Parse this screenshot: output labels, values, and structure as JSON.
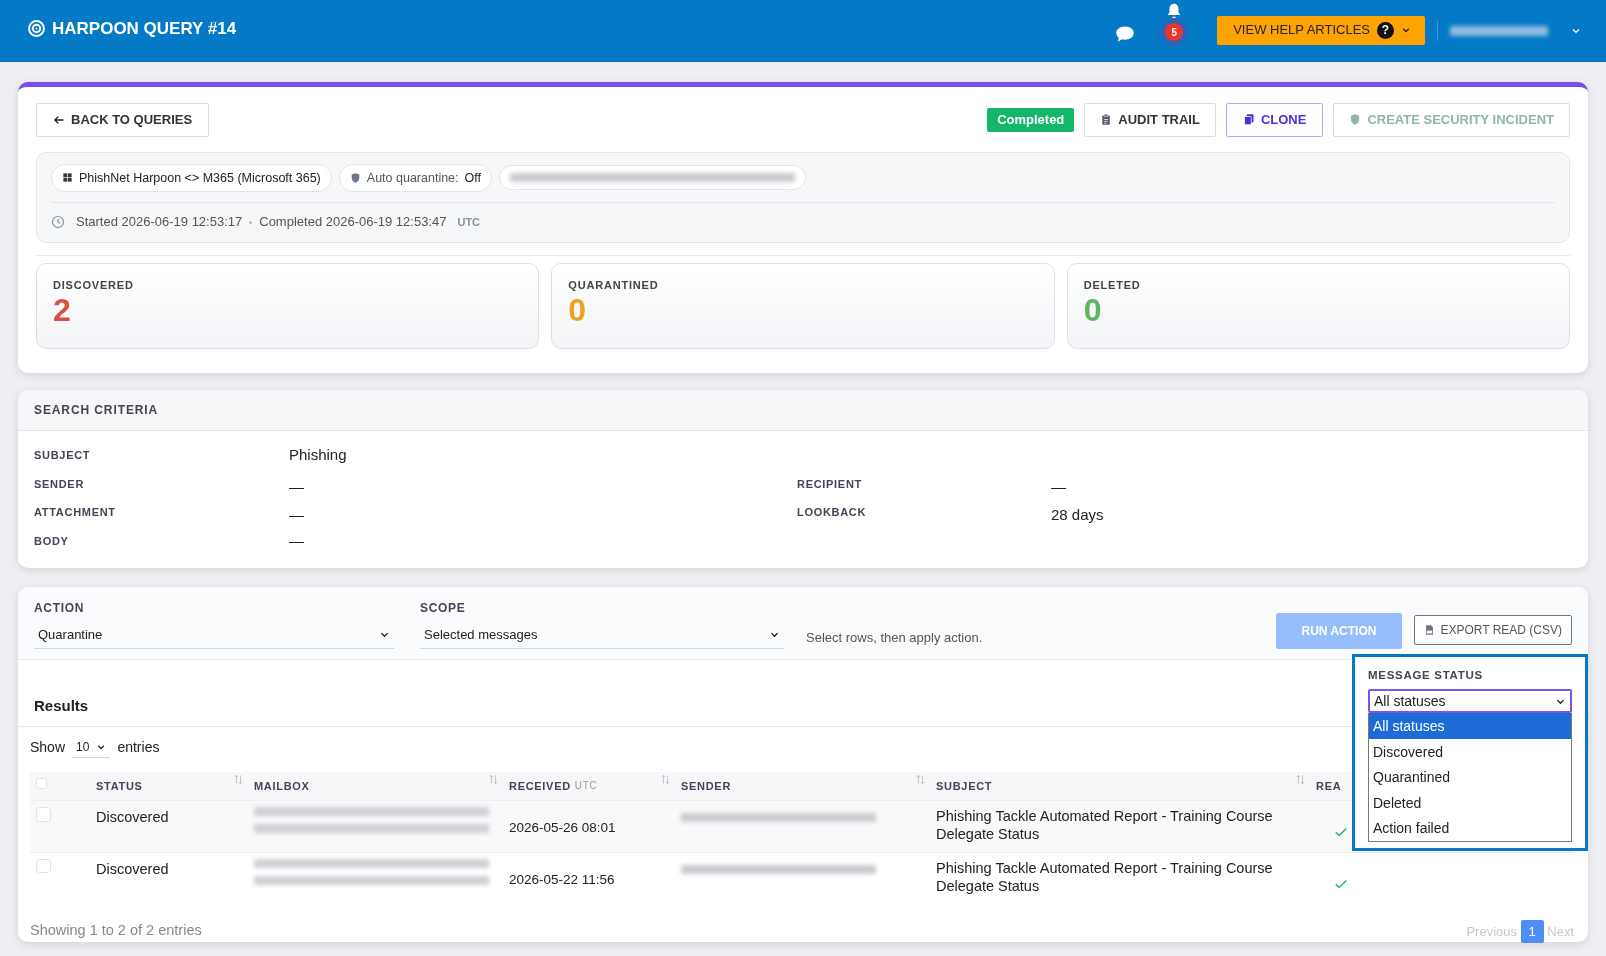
{
  "header": {
    "title": "HARPOON QUERY #14",
    "notifications": "5",
    "help_button": "VIEW HELP ARTICLES",
    "help_badge": "?"
  },
  "query": {
    "back": "BACK TO QUERIES",
    "status": "Completed",
    "actions": [
      {
        "kind": "audit",
        "label": "AUDIT TRAIL"
      },
      {
        "kind": "clone",
        "label": "CLONE"
      },
      {
        "kind": "incident",
        "label": "CREATE SECURITY INCIDENT"
      }
    ],
    "chips": [
      {
        "kind": "integration",
        "label": "PhishNet Harpoon <> M365 (Microsoft 365)"
      },
      {
        "kind": "quarantine",
        "label": "Auto quarantine:",
        "value": "Off"
      }
    ],
    "times": {
      "started_label": "Started",
      "started": "2026-06-19 12:53:17",
      "completed_label": "Completed",
      "completed": "2026-06-19 12:53:47",
      "timezone": "UTC"
    },
    "stats": [
      {
        "label": "DISCOVERED",
        "value": "2",
        "color": "#dc4e46"
      },
      {
        "label": "QUARANTINED",
        "value": "0",
        "color": "#f0a21e"
      },
      {
        "label": "DELETED",
        "value": "0",
        "color": "#5cb85c"
      }
    ]
  },
  "criteria": {
    "title": "SEARCH CRITERIA",
    "rows": [
      [
        {
          "label": "SUBJECT",
          "value": "Phishing"
        }
      ],
      [
        {
          "label": "SENDER",
          "value": "—"
        },
        {
          "label": "RECIPIENT",
          "value": "—"
        }
      ],
      [
        {
          "label": "ATTACHMENT",
          "value": "—"
        },
        {
          "label": "LOOKBACK",
          "value": "28 days"
        }
      ],
      [
        {
          "label": "BODY",
          "value": "—"
        }
      ]
    ]
  },
  "action_bar": {
    "action": {
      "label": "ACTION",
      "value": "Quarantine"
    },
    "scope": {
      "label": "SCOPE",
      "value": "Selected messages"
    },
    "hint": "Select rows, then apply action.",
    "run": {
      "label": "RUN ACTION",
      "disabled": true
    },
    "export": "EXPORT READ (CSV)"
  },
  "results": {
    "title": "Results",
    "show": "Show",
    "page_size": "10",
    "entries": "entries",
    "select_all": {
      "checked": false
    },
    "columns": [
      {
        "label": "STATUS",
        "sortable": true
      },
      {
        "label": "MAILBOX",
        "sortable": true
      },
      {
        "label": "RECEIVED",
        "unit": "UTC",
        "sortable": true
      },
      {
        "label": "SENDER",
        "sortable": true
      },
      {
        "label": "SUBJECT",
        "sortable": true
      },
      {
        "label": "REA"
      }
    ],
    "rows": [
      {
        "selected": false,
        "status": "Discovered",
        "received": "2026-05-26 08:01",
        "subject": "Phishing Tackle Automated Report - Training Course Delegate Status",
        "read": true
      },
      {
        "selected": false,
        "status": "Discovered",
        "received": "2026-05-22 11:56",
        "subject": "Phishing Tackle Automated Report - Training Course Delegate Status",
        "read": true
      }
    ],
    "info": "Showing 1 to 2 of 2 entries",
    "pagination": {
      "previous": "Previous",
      "next": "Next",
      "pages": [
        {
          "label": "1",
          "selected": true
        }
      ]
    }
  },
  "status_filter": {
    "label": "MESSAGE STATUS",
    "value": "All statuses",
    "open": true,
    "options": [
      {
        "label": "All statuses",
        "selected": true
      },
      {
        "label": "Discovered",
        "selected": false
      },
      {
        "label": "Quarantined",
        "selected": false
      },
      {
        "label": "Deleted",
        "selected": false
      },
      {
        "label": "Action failed",
        "selected": false
      }
    ]
  }
}
